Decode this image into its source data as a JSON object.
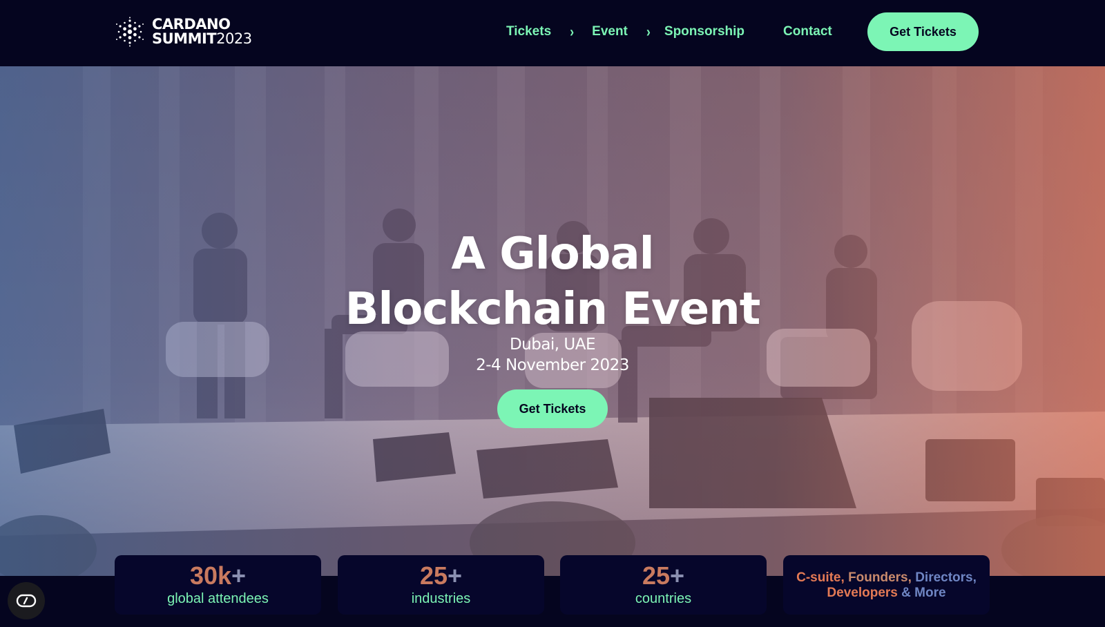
{
  "brand": {
    "line1": "CARDANO",
    "line2": "SUMMIT",
    "year": "2023",
    "icon": "cardano-logo-icon"
  },
  "nav": {
    "items": [
      {
        "label": "Tickets",
        "has_chevron": true
      },
      {
        "label": "Event",
        "has_chevron": true
      },
      {
        "label": "Sponsorship",
        "has_chevron": false
      },
      {
        "label": "Contact",
        "has_chevron": false
      }
    ],
    "chevron_icon": "chevron-right-icon",
    "cta_label": "Get Tickets"
  },
  "hero": {
    "title_line1": "A Global",
    "title_line2": "Blockchain Event",
    "location": "Dubai, UAE",
    "dates": "2-4 November 2023",
    "cta_label": "Get Tickets",
    "image_description": "panel of speakers seated on stage"
  },
  "stats": [
    {
      "value": "30k",
      "suffix": "+",
      "label": "global attendees"
    },
    {
      "value": "25",
      "suffix": "+",
      "label": "industries"
    },
    {
      "value": "25",
      "suffix": "+",
      "label": "countries"
    }
  ],
  "audience": {
    "part1": "C-suite,",
    "part2": "Founders,",
    "part3": "Directors,",
    "part4": "Developers",
    "part5": "& More"
  },
  "privacy": {
    "icon": "cookie-settings-icon"
  },
  "colors": {
    "background": "#05051f",
    "accent_green": "#7cf5b5",
    "accent_orange": "#c97a5f",
    "accent_blue": "#6f86c4"
  }
}
